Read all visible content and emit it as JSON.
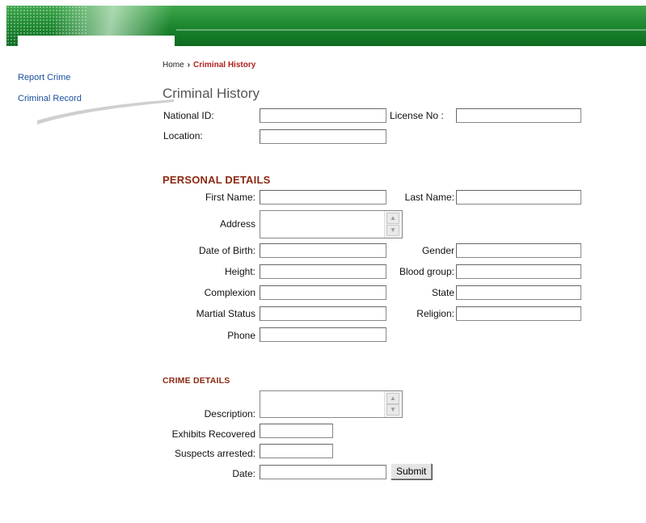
{
  "sidebar": {
    "links": [
      "Report Crime",
      "Criminal Record"
    ]
  },
  "breadcrumb": {
    "home": "Home",
    "separator": "›",
    "current": "Criminal History"
  },
  "page_title": "Criminal History",
  "search": {
    "national_id_label": "National ID:",
    "license_label": "License No :",
    "location_label": "Location:"
  },
  "personal": {
    "heading": "PERSONAL DETAILS",
    "first_name": "First Name:",
    "last_name": "Last Name:",
    "address": "Address",
    "dob": "Date of Birth:",
    "gender": "Gender",
    "height": "Height:",
    "blood_group": "Blood group:",
    "complexion": "Complexion",
    "state": "State",
    "martial_status": "Martial Status",
    "religion": "Religion:",
    "phone": "Phone"
  },
  "crime": {
    "heading": "CRIME DETAILS",
    "description": "Description:",
    "exhibits": "Exhibits Recovered",
    "suspects": "Suspects arrested:",
    "date": "Date:",
    "submit": "Submit"
  },
  "colors": {
    "banner_green": "#1f8a32",
    "link_blue": "#1a4f9c",
    "breadcrumb_red": "#b32020",
    "section_brown": "#8a2a12"
  }
}
